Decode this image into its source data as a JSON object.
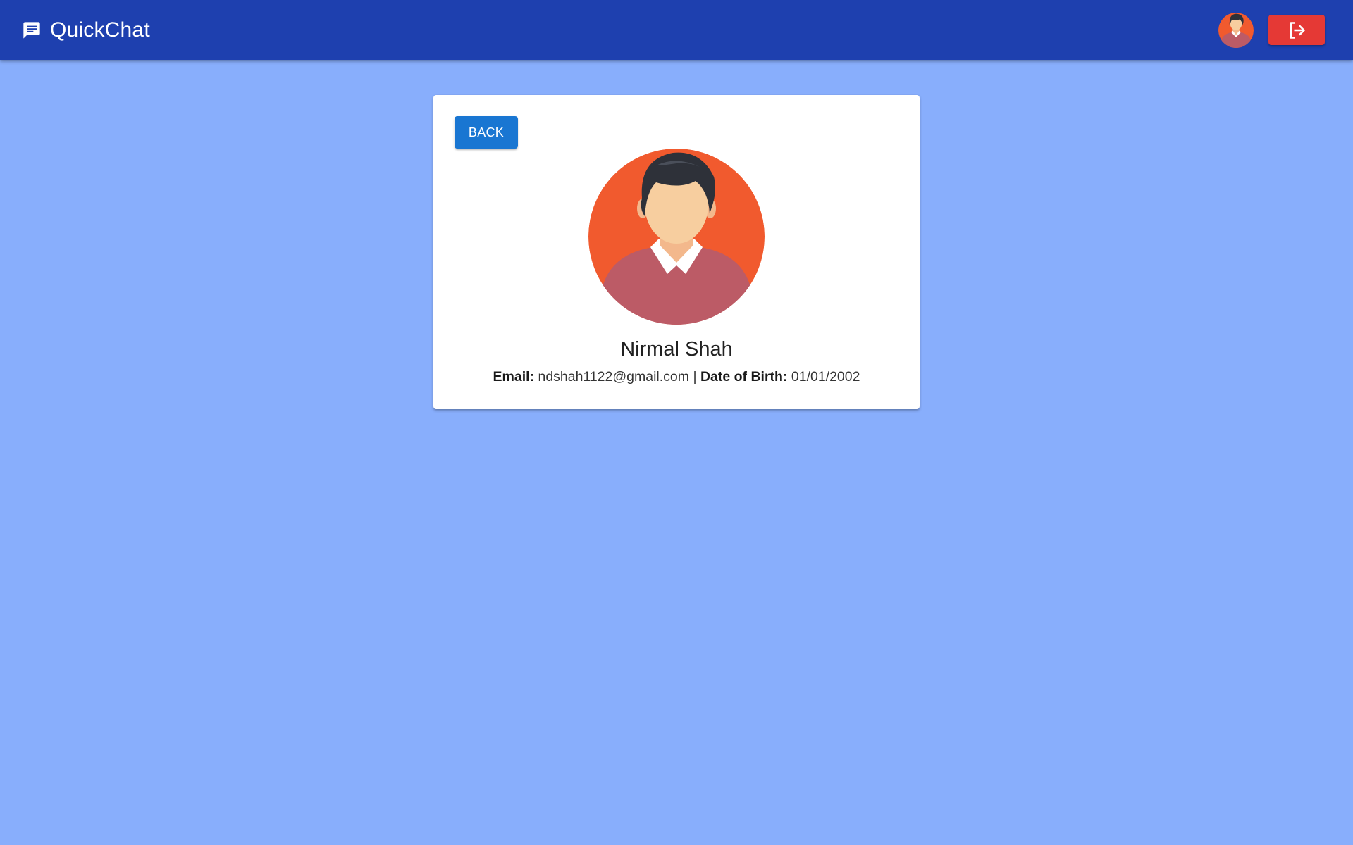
{
  "header": {
    "brand_title": "QuickChat",
    "brand_icon": "chat-message-icon",
    "avatar_icon": "user-avatar",
    "logout_icon": "logout-icon",
    "colors": {
      "appbar": "#1e40af",
      "logout": "#e53935"
    }
  },
  "profile": {
    "back_label": "BACK",
    "name": "Nirmal Shah",
    "email_label": "Email:",
    "email": "ndshah1122@gmail.com",
    "separator": "|",
    "dob_label": "Date of Birth:",
    "dob": "01/01/2002",
    "colors": {
      "back_button": "#1976d2",
      "page_background": "#88aefc"
    }
  }
}
